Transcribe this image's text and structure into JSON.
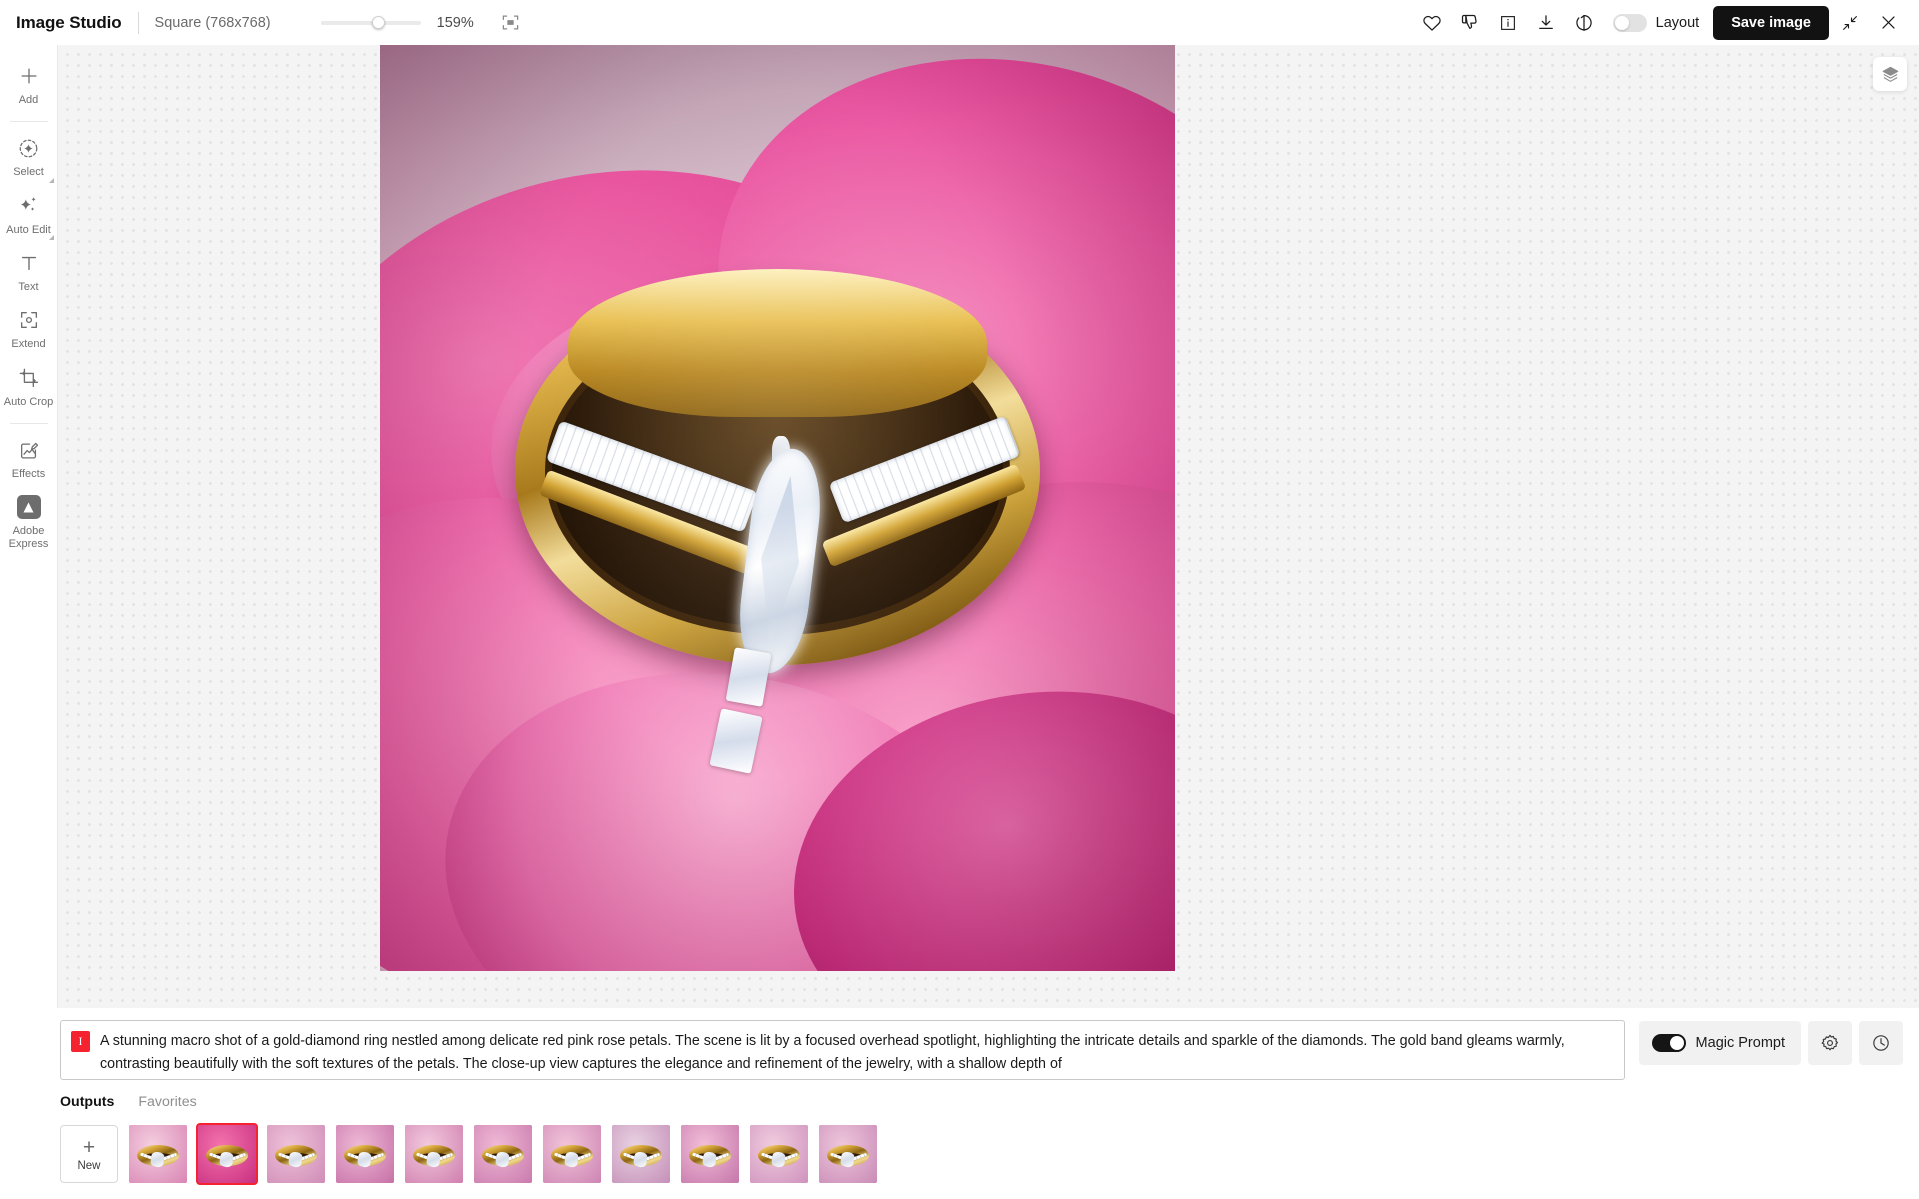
{
  "header": {
    "app_title": "Image Studio",
    "aspect_ratio": "Square (768x768)",
    "zoom_level": "159%",
    "fit_icon": "fit-to-screen-icon",
    "like_icon": "heart-icon",
    "dislike_icon": "thumbs-down-icon",
    "info_icon": "info-icon",
    "download_icon": "download-icon",
    "refresh_icon": "rotate-refresh-icon",
    "layout_toggle_label": "Layout",
    "layout_toggle_on": false,
    "save_label": "Save image",
    "collapse_icon": "collapse-arrows-icon",
    "close_icon": "close-icon"
  },
  "sidebar": {
    "items": [
      {
        "label": "Add",
        "icon": "plus-icon",
        "has_submenu": false
      },
      {
        "label": "Select",
        "icon": "select-point-icon",
        "has_submenu": true
      },
      {
        "label": "Auto Edit",
        "icon": "sparkles-icon",
        "has_submenu": true
      },
      {
        "label": "Text",
        "icon": "text-t-icon",
        "has_submenu": false
      },
      {
        "label": "Extend",
        "icon": "extend-frame-icon",
        "has_submenu": false
      },
      {
        "label": "Auto Crop",
        "icon": "crop-icon",
        "has_submenu": false
      },
      {
        "label": "Effects",
        "icon": "effects-pencil-icon",
        "has_submenu": false
      },
      {
        "label": "Adobe Express",
        "icon": "adobe-express-icon",
        "has_submenu": false
      }
    ]
  },
  "canvas": {
    "layers_icon": "layers-icon",
    "image_alt": "gold diamond ring on pink rose petals"
  },
  "prompt": {
    "badge": "I",
    "text": "A stunning macro shot of a gold-diamond ring nestled among delicate red pink rose petals. The scene is lit by a focused overhead spotlight, highlighting the intricate details and sparkle of the diamonds. The gold band gleams warmly, contrasting beautifully with the soft textures of the petals. The close-up view captures the elegance and refinement of the jewelry, with a shallow depth of",
    "magic_prompt_label": "Magic Prompt",
    "magic_prompt_on": true,
    "settings_icon": "gear-icon",
    "history_icon": "clock-history-icon"
  },
  "gallery": {
    "tabs": [
      {
        "label": "Outputs",
        "active": true
      },
      {
        "label": "Favorites",
        "active": false
      }
    ],
    "new_label": "New",
    "new_icon": "plus-icon",
    "thumbnails": [
      {
        "selected": false,
        "bg_a": "#f4cfe0",
        "bg_b": "#d985b4"
      },
      {
        "selected": true,
        "bg_a": "#f472ad",
        "bg_b": "#c92f80"
      },
      {
        "selected": false,
        "bg_a": "#efc2da",
        "bg_b": "#cf8cb6"
      },
      {
        "selected": false,
        "bg_a": "#eeb9d6",
        "bg_b": "#c670a6"
      },
      {
        "selected": false,
        "bg_a": "#f3c9de",
        "bg_b": "#cf7fae"
      },
      {
        "selected": false,
        "bg_a": "#f0b9d6",
        "bg_b": "#c97aac"
      },
      {
        "selected": false,
        "bg_a": "#f1c4da",
        "bg_b": "#cd84b2"
      },
      {
        "selected": false,
        "bg_a": "#e8d2e2",
        "bg_b": "#c58fb8"
      },
      {
        "selected": false,
        "bg_a": "#f2bed8",
        "bg_b": "#c576aa"
      },
      {
        "selected": false,
        "bg_a": "#f0ccdf",
        "bg_b": "#cf92bd"
      },
      {
        "selected": false,
        "bg_a": "#eec6dc",
        "bg_b": "#c98bb6"
      }
    ]
  },
  "colors": {
    "accent_red": "#f5232f",
    "dark_button": "#121212",
    "canvas_bg": "#f4f4f4"
  }
}
